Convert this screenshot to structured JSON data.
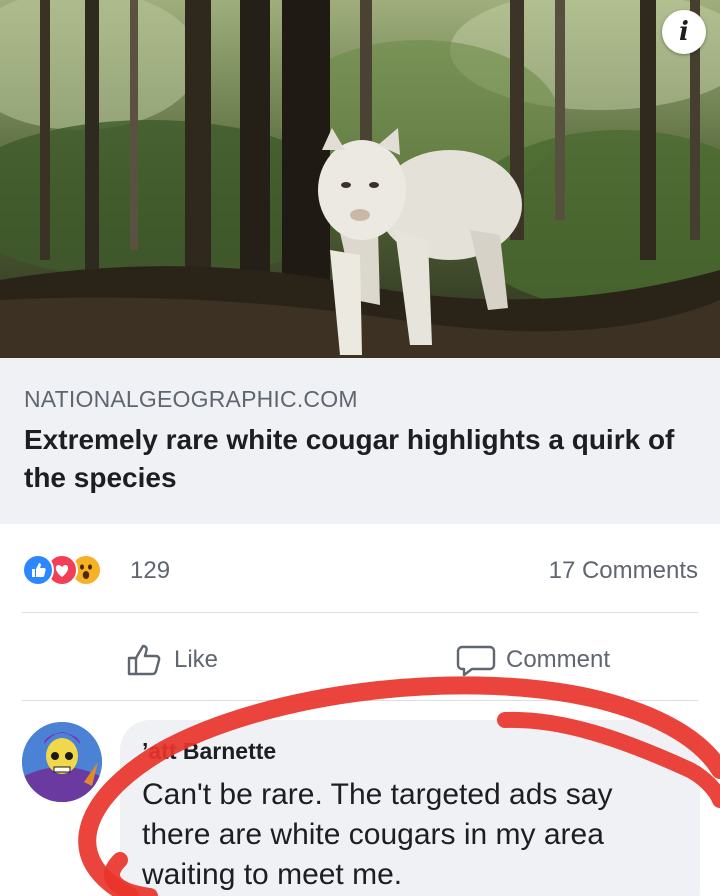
{
  "link_preview": {
    "domain": "NATIONALGEOGRAPHIC.COM",
    "title": "Extremely rare white cougar highlights a quirk of the species",
    "info_icon": "info-icon"
  },
  "reactions": {
    "icons": [
      "like-reaction-icon",
      "love-reaction-icon",
      "wow-reaction-icon"
    ],
    "count": "129",
    "comments_count": "17 Comments"
  },
  "actions": {
    "like_label": "Like",
    "comment_label": "Comment"
  },
  "comment": {
    "author": "Matt Barnette",
    "author_visible": "’att Barnette",
    "text": "Can't be rare. The targeted ads say there are white cougars in my area waiting to meet me."
  },
  "colors": {
    "like_blue": "#2d88ff",
    "love_red": "#f33e58",
    "wow_yellow": "#f7b125",
    "marker_red": "#e8342b",
    "preview_bg": "#eff1f4"
  }
}
